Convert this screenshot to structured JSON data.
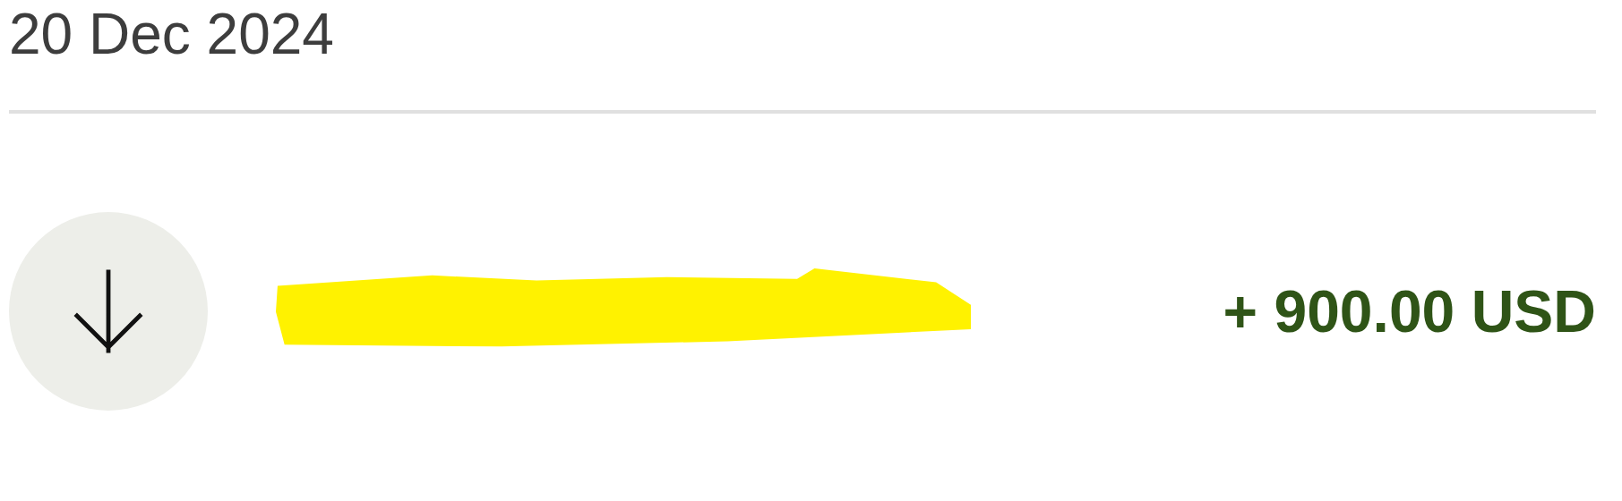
{
  "date_header": "20 Dec 2024",
  "transactions": [
    {
      "kind": "incoming",
      "redacted": true,
      "amount": "+ 900.00 USD"
    }
  ]
}
